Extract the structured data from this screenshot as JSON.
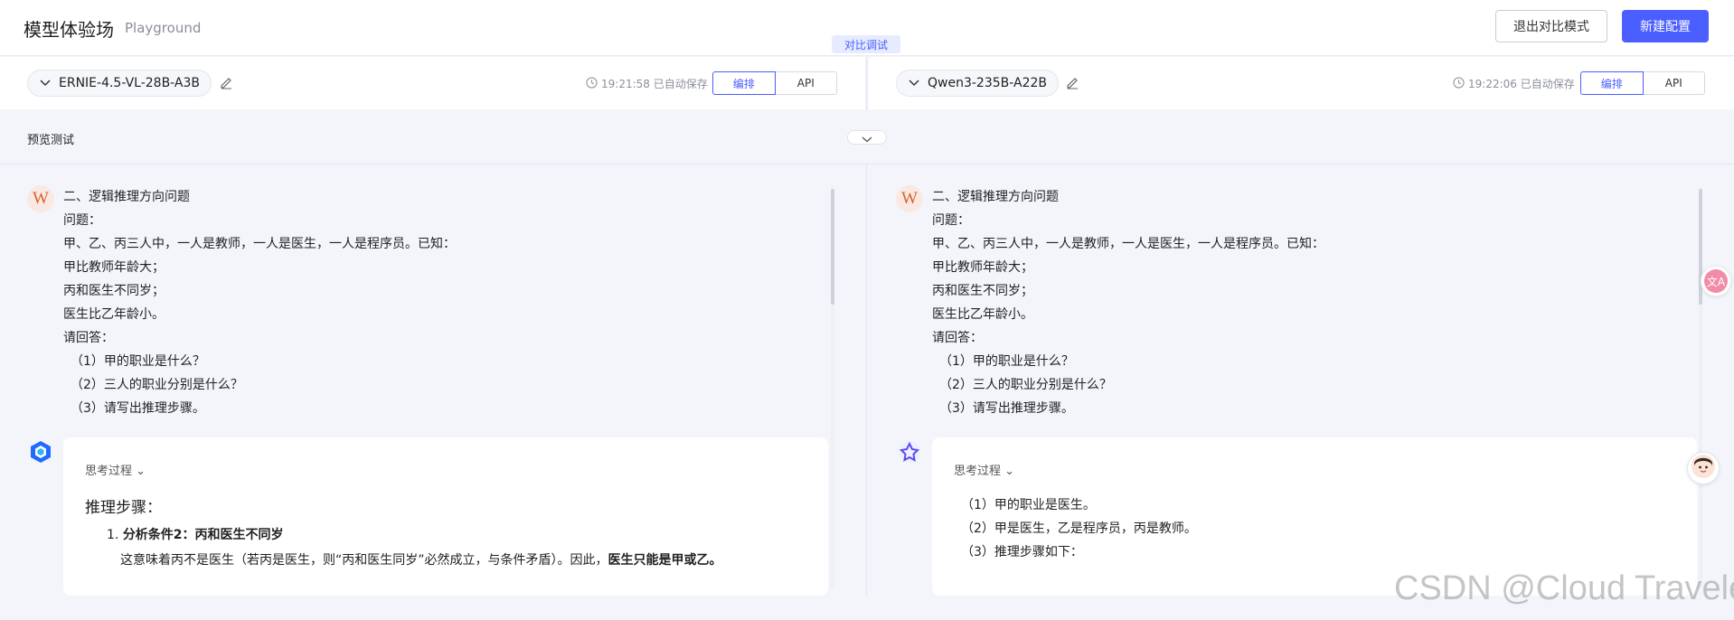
{
  "header": {
    "title": "模型体验场",
    "subtitle": "Playground",
    "exit_compare_label": "退出对比模式",
    "new_config_label": "新建配置",
    "compare_tag": "对比调试"
  },
  "panes": [
    {
      "model_name": "ERNIE-4.5-VL-28B-A3B",
      "save_status": "19:21:58 已自动保存",
      "seg_layout": "编排",
      "seg_api": "API"
    },
    {
      "model_name": "Qwen3-235B-A22B",
      "save_status": "19:22:06 已自动保存",
      "seg_layout": "编排",
      "seg_api": "API"
    }
  ],
  "preview": {
    "label": "预览测试"
  },
  "user_message": {
    "avatar_letter": "W",
    "lines": [
      "二、逻辑推理方向问题",
      "问题：",
      "甲、乙、丙三人中，一人是教师，一人是医生，一人是程序员。已知：",
      "甲比教师年龄大；",
      "丙和医生不同岁；",
      "医生比乙年龄小。",
      "请回答：",
      "（1）甲的职业是什么？",
      "（2）三人的职业分别是什么？",
      "（3）请写出推理步骤。"
    ]
  },
  "reply_left": {
    "think_label": "思考过程",
    "heading": "推理步骤：",
    "item_num": "1.",
    "item_title": "分析条件2：丙和医生不同岁",
    "para_text": "这意味着丙不是医生（若丙是医生，则“丙和医生同岁”必然成立，与条件矛盾）。因此，",
    "para_bold": "医生只能是甲或乙。"
  },
  "reply_right": {
    "think_label": "思考过程",
    "lines": [
      "（1）甲的职业是医生。",
      "（2）甲是医生，乙是程序员，丙是教师。",
      "（3）推理步骤如下："
    ]
  },
  "watermark": "CSDN @Cloud Traveler",
  "colors": {
    "accent": "#4b5eff",
    "background": "#f3f5fa",
    "user_avatar": "#d9622b"
  },
  "icons": {
    "model_dropdown": "chevron-down-icon",
    "edit": "pencil-icon",
    "save": "clock-icon",
    "bot_left": "ernie-logo-icon",
    "bot_right": "qwen-logo-icon"
  }
}
